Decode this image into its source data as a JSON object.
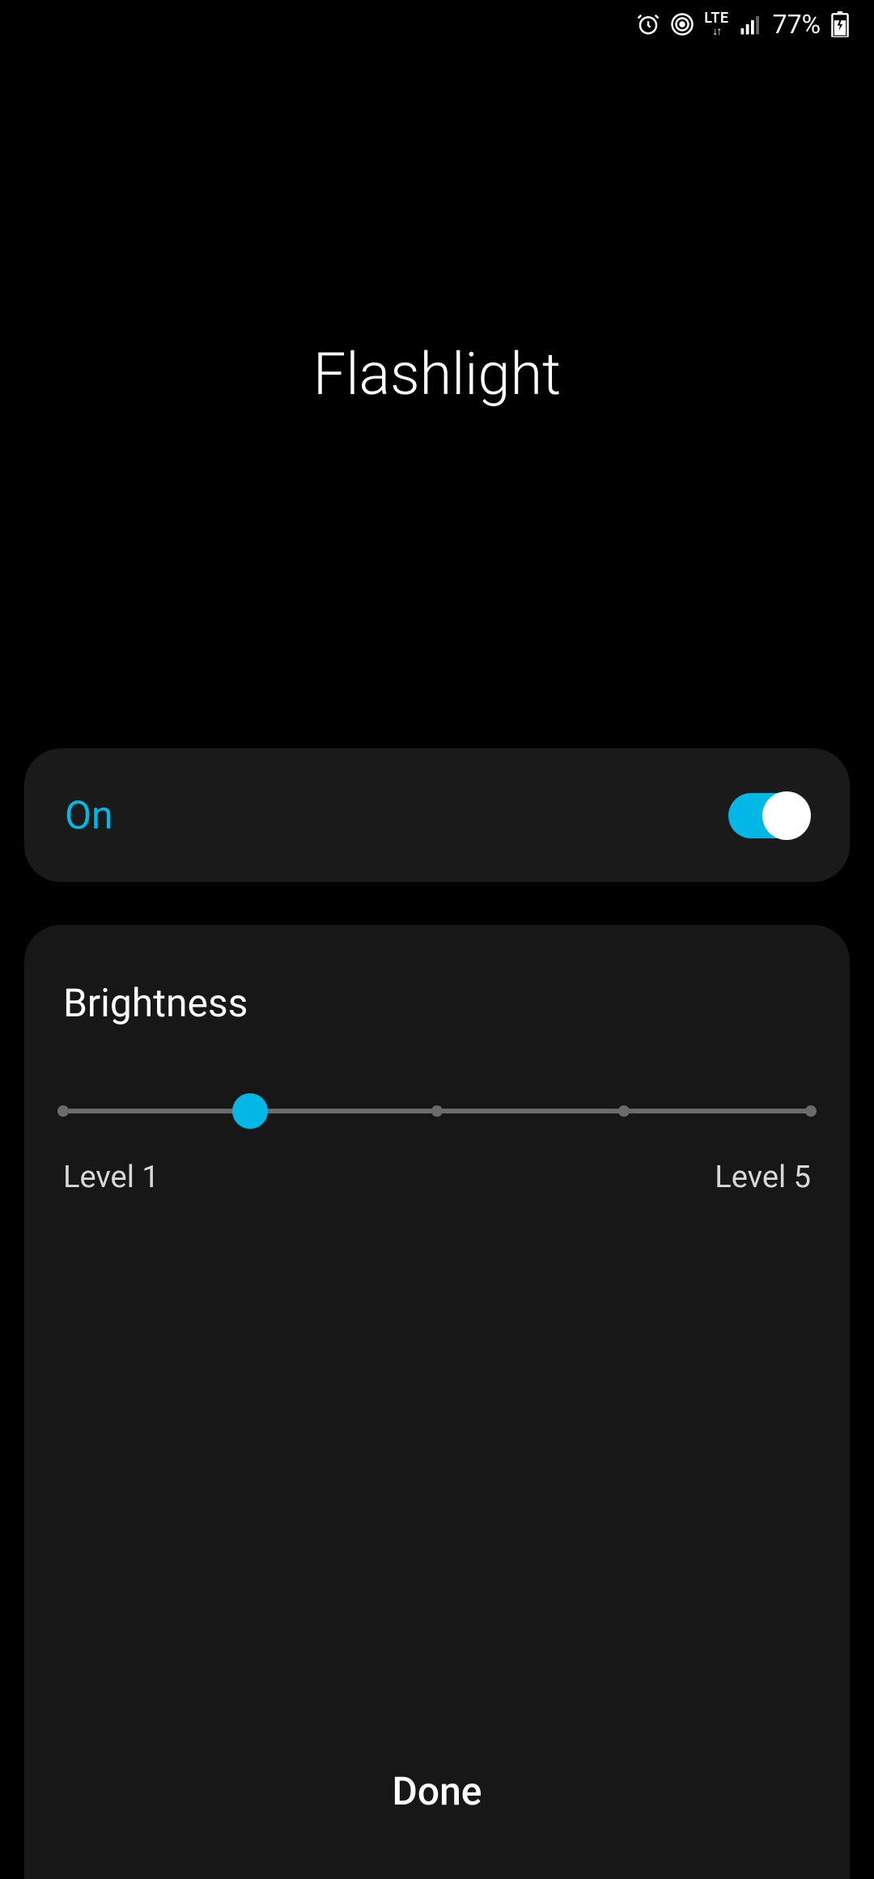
{
  "statusBar": {
    "networkType": "LTE",
    "batteryPercent": "77%"
  },
  "title": "Flashlight",
  "toggle": {
    "label": "On",
    "state": true
  },
  "brightness": {
    "title": "Brightness",
    "minLabel": "Level 1",
    "maxLabel": "Level 5",
    "currentLevel": 2,
    "minLevel": 1,
    "maxLevel": 5
  },
  "doneButton": "Done",
  "colors": {
    "accent": "#00b7e6",
    "background": "#000000",
    "cardBackground": "#171717"
  }
}
